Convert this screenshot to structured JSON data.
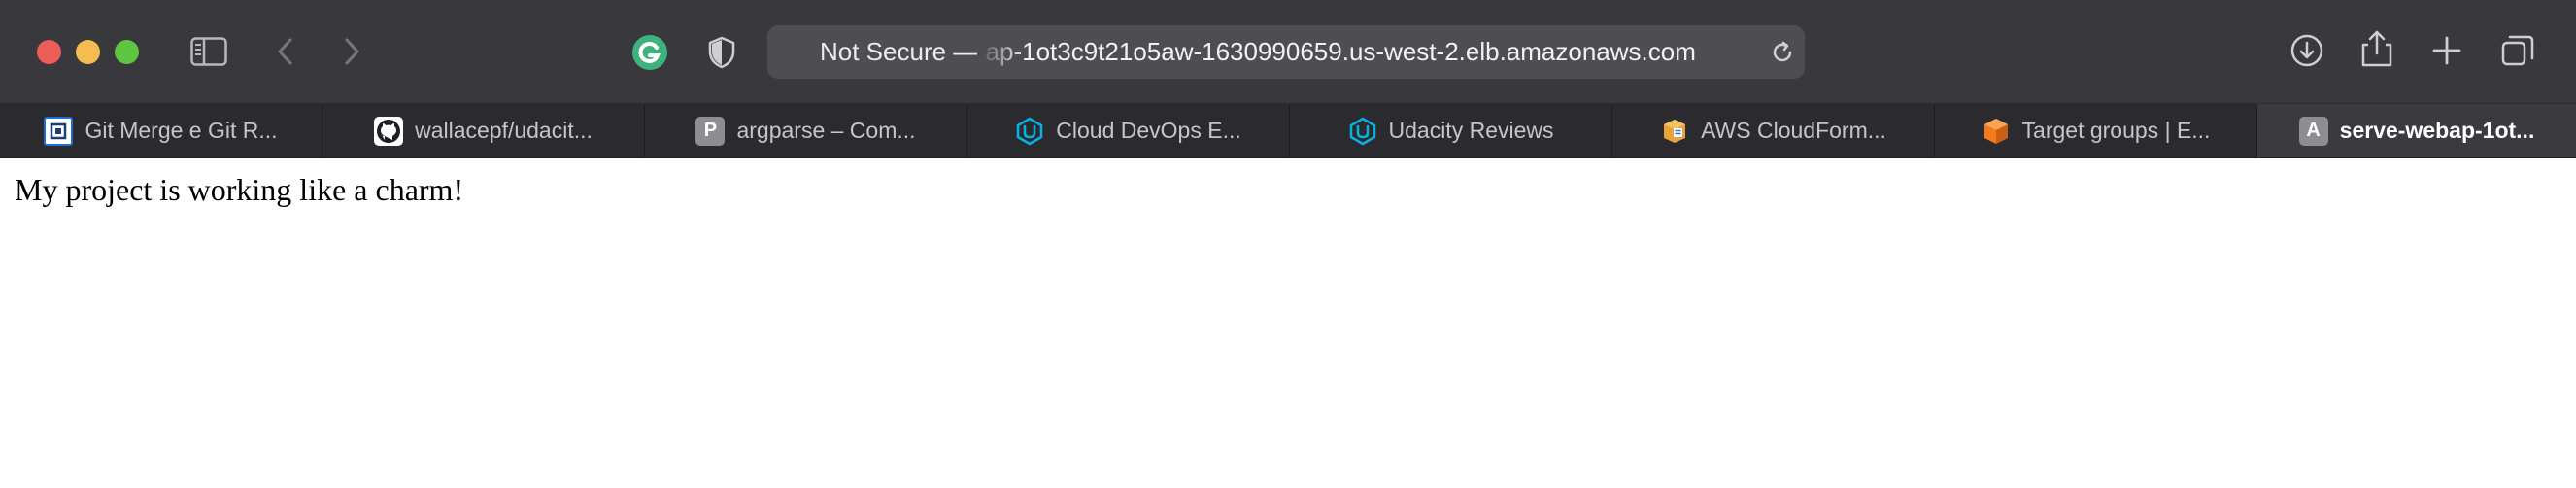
{
  "browser": {
    "traffic_lights": {
      "close_color": "#ee5e58",
      "minimize_color": "#f4bd4f",
      "zoom_color": "#5ec541"
    },
    "toolbar_icons": [
      "sidebar-icon",
      "back-icon",
      "forward-icon",
      "grammarly-icon",
      "shield-icon",
      "reload-icon",
      "download-icon",
      "share-icon",
      "plus-icon",
      "tabs-overview-icon"
    ],
    "address_bar": {
      "prefix": "Not Secure —",
      "url": "ap-1ot3c9t21o5aw-1630990659.us-west-2.elb.amazonaws.com"
    }
  },
  "tabs": [
    {
      "label": "Git Merge e Git R...",
      "favicon": "git-merge-favicon"
    },
    {
      "label": "wallacepf/udacit...",
      "favicon": "github-favicon"
    },
    {
      "label": "argparse – Com...",
      "favicon": "letter-p-favicon",
      "favicon_text": "P"
    },
    {
      "label": "Cloud DevOps E...",
      "favicon": "udacity-favicon"
    },
    {
      "label": "Udacity Reviews",
      "favicon": "udacity-favicon"
    },
    {
      "label": "AWS CloudForm...",
      "favicon": "aws-cloudformation-favicon"
    },
    {
      "label": "Target groups | E...",
      "favicon": "aws-ec2-favicon"
    },
    {
      "label": "serve-webap-1ot...",
      "favicon": "letter-a-favicon",
      "favicon_text": "A",
      "active": true
    }
  ],
  "page": {
    "message": "My project is working like a charm!"
  }
}
